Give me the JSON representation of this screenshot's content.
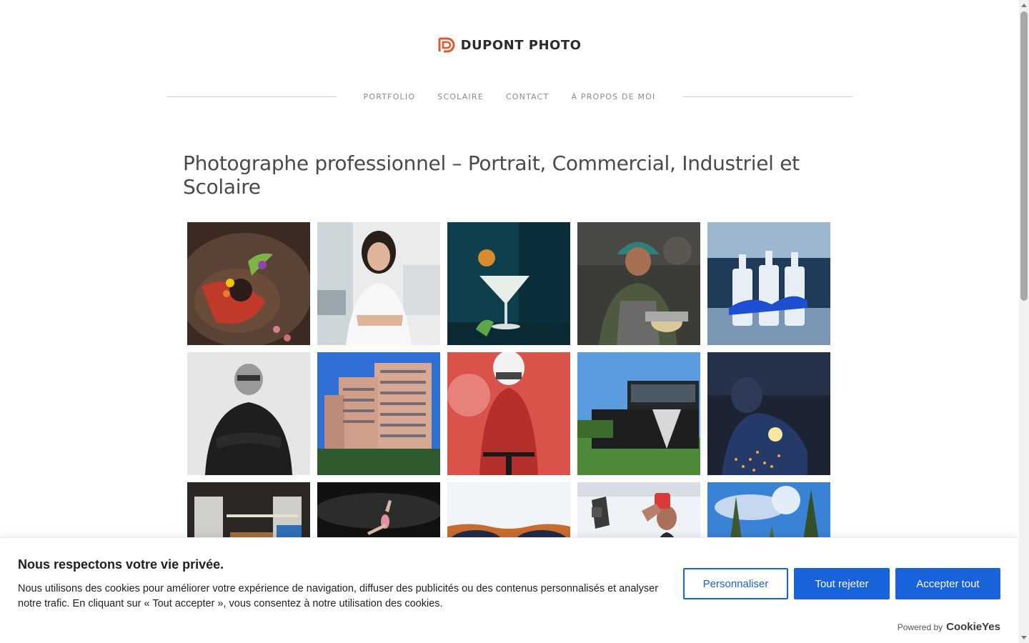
{
  "brand": {
    "name": "DUPONT PHOTO",
    "accent_color": "#e4572e"
  },
  "nav": {
    "items": [
      {
        "label": "PORTFOLIO"
      },
      {
        "label": "SCOLAIRE"
      },
      {
        "label": "CONTACT"
      },
      {
        "label": "À PROPOS DE MOI"
      }
    ]
  },
  "page": {
    "title": "Photographe professionnel – Portrait, Commercial, Industriel et Scolaire"
  },
  "gallery": {
    "tiles": [
      {
        "subject": "plated-dish-with-flowers"
      },
      {
        "subject": "woman-business-portrait"
      },
      {
        "subject": "cocktail-glass"
      },
      {
        "subject": "worker-with-hardhat"
      },
      {
        "subject": "three-bottles-waterfall"
      },
      {
        "subject": "man-black-and-white-portrait"
      },
      {
        "subject": "residential-tower"
      },
      {
        "subject": "cyclist-red-background"
      },
      {
        "subject": "modern-building"
      },
      {
        "subject": "welder-sparks"
      },
      {
        "subject": "dark-room-interior"
      },
      {
        "subject": "dancer-dark"
      },
      {
        "subject": "sunglasses"
      },
      {
        "subject": "athlete-drinking"
      },
      {
        "subject": "pine-trees-sky"
      }
    ]
  },
  "cookie": {
    "title": "Nous respectons votre vie privée.",
    "text": "Nous utilisons des cookies pour améliorer votre expérience de navigation, diffuser des publicités ou des contenus personnalisés et analyser notre trafic. En cliquant sur « Tout accepter », vous consentez à notre utilisation des cookies.",
    "customize_label": "Personnaliser",
    "reject_label": "Tout rejeter",
    "accept_label": "Accepter tout",
    "powered_label": "Powered by",
    "powered_brand": "CookieYes",
    "button_color": "#1863dc"
  }
}
